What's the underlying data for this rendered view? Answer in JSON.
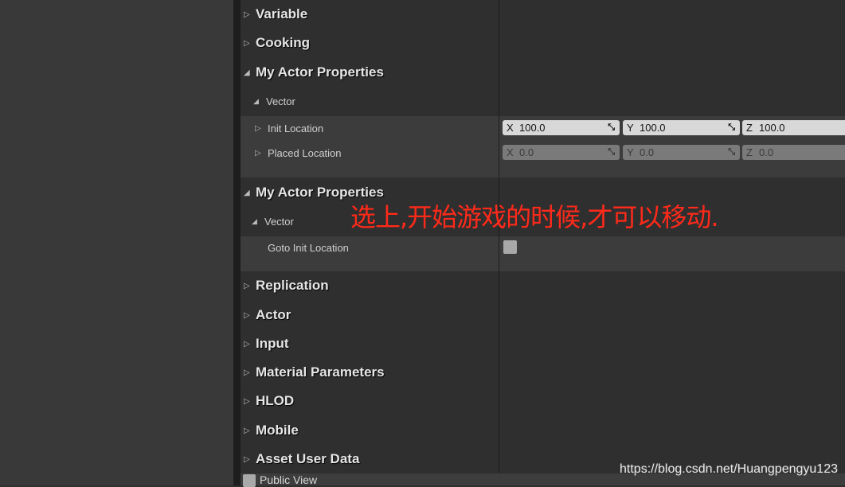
{
  "categories_top": [
    {
      "label": "Variable",
      "expanded": false
    },
    {
      "label": "Cooking",
      "expanded": false
    },
    {
      "label": "My Actor Properties",
      "expanded": true
    }
  ],
  "section1": {
    "sub": "Vector",
    "props": [
      {
        "label": "Init Location",
        "x": "100.0",
        "y": "100.0",
        "z": "100.0",
        "enabled": true
      },
      {
        "label": "Placed Location",
        "x": "0.0",
        "y": "0.0",
        "z": "0.0",
        "enabled": false
      }
    ]
  },
  "section2": {
    "title": "My Actor Properties",
    "sub": "Vector",
    "prop": "Goto Init Location",
    "checked": false
  },
  "annotation": "选上,开始游戏的时候,才可以移动.",
  "categories_bottom": [
    "Replication",
    "Actor",
    "Input",
    "Material Parameters",
    "HLOD",
    "Mobile",
    "Asset User Data"
  ],
  "axes": [
    "X",
    "Y",
    "Z"
  ],
  "bottom": {
    "public_view": "Public View",
    "checked": false
  },
  "watermark": "https://blog.csdn.net/Huangpengyu123",
  "colors": {
    "annotation": "#ff2a1a",
    "background": "#2f2f2f"
  }
}
